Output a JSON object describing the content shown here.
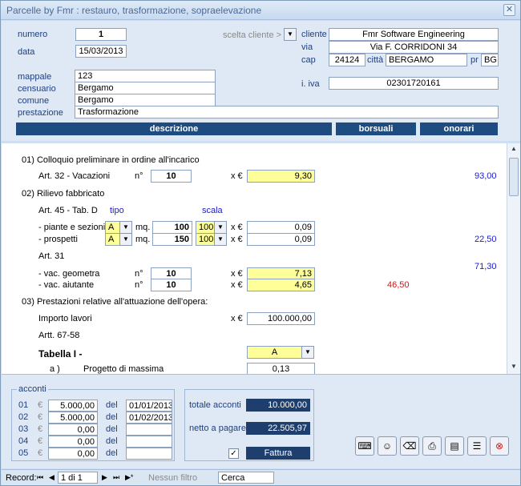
{
  "window": {
    "title": "Parcelle by Fmr : restauro, trasformazione, sopraelevazione"
  },
  "header": {
    "numero_label": "numero",
    "numero": "1",
    "data_label": "data",
    "data": "15/03/2013",
    "scelta_label": "scelta cliente >",
    "cliente_label": "cliente",
    "cliente": "Fmr Software Engineering",
    "via_label": "via",
    "via": "Via F. CORRIDONI 34",
    "cap_label": "cap",
    "cap": "24124",
    "citta_label": "città",
    "citta": "BERGAMO",
    "pr_label": "pr",
    "pr": "BG",
    "mappale_label": "mappale",
    "mappale": "123",
    "censuario_label": "censuario",
    "censuario": "Bergamo",
    "comune_label": "comune",
    "comune": "Bergamo",
    "prestazione_label": "prestazione",
    "prestazione": "Trasformazione",
    "iva_label": "i. iva",
    "iva": "02301720161",
    "col_descrizione": "descrizione",
    "col_borsuali": "borsuali",
    "col_onorari": "onorari"
  },
  "detail": {
    "s01": "01) Colloquio preliminare in ordine all'incarico",
    "art32": "Art. 32 - Vacazioni",
    "n_label": "n°",
    "n_vac": "10",
    "xe": "x €",
    "val_vac": "9,30",
    "onor_vac": "93,00",
    "s02": "02) Rilievo fabbricato",
    "art45": "Art. 45 - Tab. D",
    "tipo_label": "tipo",
    "scala_label": "scala",
    "piante": "- piante e sezioni",
    "piante_tipo": "A",
    "mq_label": "mq.",
    "piante_mq": "100",
    "piante_scala": "100",
    "piante_val": "0,09",
    "prospetti": "- prospetti",
    "prospetti_tipo": "A",
    "prospetti_mq": "150",
    "prospetti_scala": "100",
    "prospetti_val": "0,09",
    "onor_rilievo": "22,50",
    "art31": "Art. 31",
    "onor_art31": "71,30",
    "geom": "- vac. geometra",
    "geom_n": "10",
    "geom_val": "7,13",
    "aiut": "- vac. aiutante",
    "aiut_n": "10",
    "aiut_val": "4,65",
    "bors_aiut": "46,50",
    "s03": "03) Prestazioni relative all'attuazione dell'opera:",
    "importo_label": "Importo lavori",
    "importo": "100.000,00",
    "art67": "Artt. 67-58",
    "tabella_label": "Tabella I  -",
    "tabella": "A",
    "progetto_a": "a )",
    "progetto_label": "Progetto di massima",
    "progetto_val": "0,13"
  },
  "acconti": {
    "title": "acconti",
    "euro": "€",
    "del_label": "del",
    "rows": [
      {
        "n": "01",
        "importo": "5.000,00",
        "data": "01/01/2013"
      },
      {
        "n": "02",
        "importo": "5.000,00",
        "data": "01/02/2013"
      },
      {
        "n": "03",
        "importo": "0,00",
        "data": ""
      },
      {
        "n": "04",
        "importo": "0,00",
        "data": ""
      },
      {
        "n": "05",
        "importo": "0,00",
        "data": ""
      }
    ]
  },
  "totali": {
    "totale_label": "totale acconti",
    "totale": "10.000,00",
    "netto_label": "netto a pagare",
    "netto": "22.505,97",
    "fattura": "Fattura",
    "fattura_check": "✓"
  },
  "status": {
    "record_label": "Record:",
    "position": "1 di 1",
    "filter": "Nessun filtro",
    "search": "Cerca"
  }
}
